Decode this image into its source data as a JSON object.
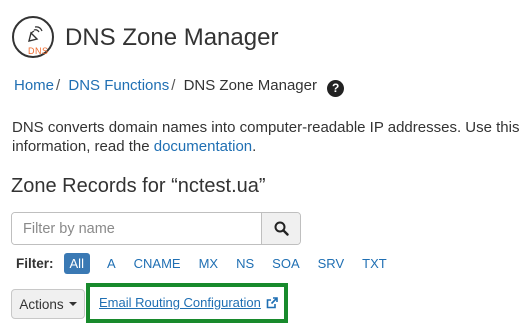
{
  "header": {
    "logo_text": "DNS",
    "title": "DNS Zone Manager"
  },
  "breadcrumb": {
    "items": [
      "Home",
      "DNS Functions",
      "DNS Zone Manager"
    ],
    "separator": "/",
    "help_glyph": "?"
  },
  "description": {
    "line1": "DNS converts domain names into computer-readable IP addresses. Use this fea",
    "line2_prefix": "information, read the ",
    "link": "documentation",
    "line2_suffix": "."
  },
  "zone_title": "Zone Records for “nctest.ua”",
  "search": {
    "placeholder": "Filter by name",
    "icon": "search-icon"
  },
  "filter": {
    "label": "Filter:",
    "options": [
      "All",
      "A",
      "CNAME",
      "MX",
      "NS",
      "SOA",
      "SRV",
      "TXT"
    ],
    "selected": "All"
  },
  "actions": {
    "label": "Actions"
  },
  "email_routing": {
    "label": "Email Routing Configuration",
    "icon": "external-link-icon",
    "highlight_color": "#188a2c"
  },
  "colors": {
    "link": "#1f6fb3",
    "active_filter": "#3a79b4",
    "logo_accent": "#ef6a2d"
  }
}
